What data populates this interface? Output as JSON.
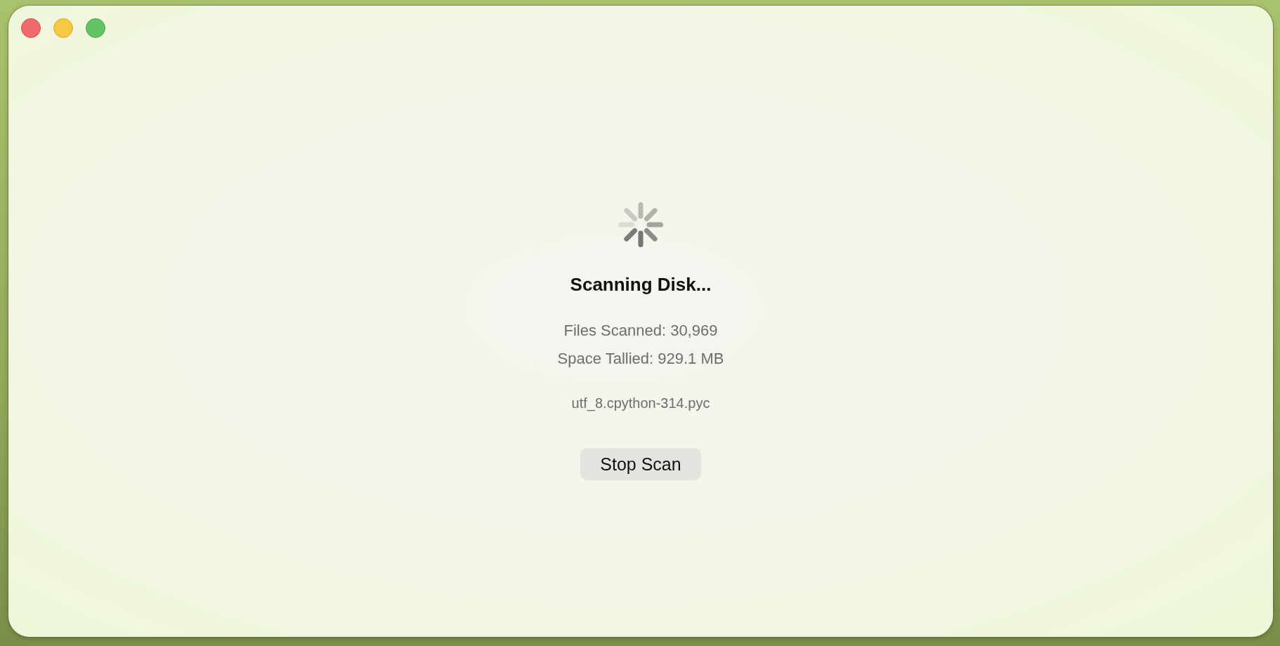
{
  "window": {
    "controls": [
      {
        "kind": "close"
      },
      {
        "kind": "minimize"
      },
      {
        "kind": "zoom"
      }
    ]
  },
  "scan": {
    "title": "Scanning Disk...",
    "stats": [
      "Files Scanned: 30,969",
      "Space Tallied: 929.1 MB"
    ],
    "current_file": "utf_8.cpython-314.pyc",
    "button": "Stop Scan"
  }
}
